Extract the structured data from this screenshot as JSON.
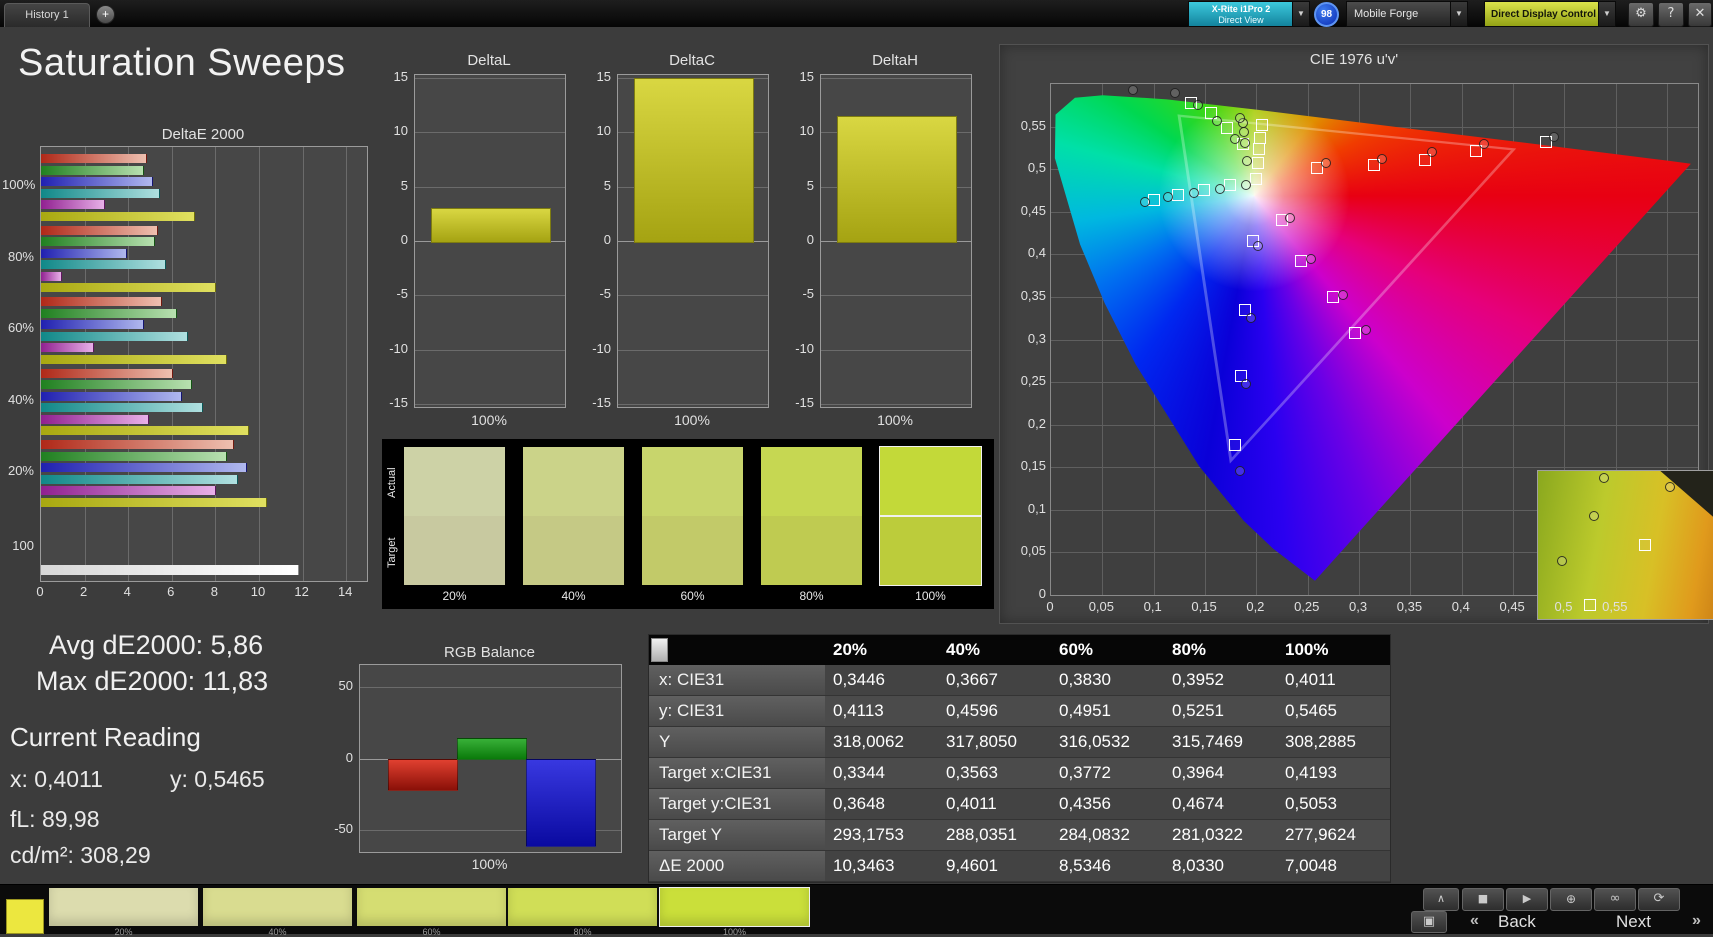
{
  "topbar": {
    "history_tab": "History 1",
    "meter": {
      "line1": "X-Rite i1Pro 2",
      "line2": "Direct View"
    },
    "badge": "98",
    "source": "Mobile Forge",
    "display_control": "Direct Display Control"
  },
  "icons": {
    "gear": "⚙",
    "help": "?",
    "close": "✕",
    "dropdown": "▼",
    "add": "+",
    "collapse": "∧",
    "stop": "■",
    "play": "▶",
    "record": "⊕",
    "loop": "∞",
    "refresh": "⟳",
    "layout": "▣",
    "prev": "«",
    "next": "»"
  },
  "title": "Saturation Sweeps",
  "charts": {
    "deltae2000": {
      "type": "bar",
      "orientation": "horizontal",
      "title": "DeltaE 2000",
      "xlim": [
        0,
        15
      ],
      "xticks": [
        0,
        2,
        4,
        6,
        8,
        10,
        12,
        14
      ],
      "series_names": [
        "Red",
        "Green",
        "Blue",
        "Cyan",
        "Magenta",
        "Yellow"
      ],
      "series_colors": [
        [
          "#b02818",
          "#eec0b0"
        ],
        [
          "#208020",
          "#b8e0b0"
        ],
        [
          "#2020b0",
          "#b0b8ee"
        ],
        [
          "#108888",
          "#b0e0e0"
        ],
        [
          "#902090",
          "#e8b0e8"
        ],
        [
          "#a8a810",
          "#e0e060"
        ]
      ],
      "groups": [
        {
          "label": "100%",
          "values": [
            4.8,
            4.7,
            5.1,
            5.4,
            2.9,
            7.0
          ]
        },
        {
          "label": "80%",
          "values": [
            5.3,
            5.2,
            3.9,
            5.7,
            0.9,
            8.0
          ]
        },
        {
          "label": "60%",
          "values": [
            5.5,
            6.2,
            4.7,
            6.7,
            2.4,
            8.5
          ]
        },
        {
          "label": "40%",
          "values": [
            6.0,
            6.9,
            6.4,
            7.4,
            4.9,
            9.5
          ]
        },
        {
          "label": "20%",
          "values": [
            8.8,
            8.5,
            9.4,
            9.0,
            8.0,
            10.3
          ]
        },
        {
          "label": "100",
          "values": [
            11.8
          ]
        }
      ]
    },
    "deltaL": {
      "type": "bar",
      "title": "DeltaL",
      "ylim": [
        -15,
        15
      ],
      "yticks": [
        15,
        10,
        5,
        0,
        -5,
        -10,
        -15
      ],
      "value": 3.0,
      "xlabel": "100%"
    },
    "deltaC": {
      "type": "bar",
      "title": "DeltaC",
      "ylim": [
        -15,
        15
      ],
      "yticks": [
        15,
        10,
        5,
        0,
        -5,
        -10,
        -15
      ],
      "value": 15.0,
      "xlabel": "100%"
    },
    "deltaH": {
      "type": "bar",
      "title": "DeltaH",
      "ylim": [
        -15,
        15
      ],
      "yticks": [
        15,
        10,
        5,
        0,
        -5,
        -10,
        -15
      ],
      "value": 11.5,
      "xlabel": "100%"
    },
    "rgb_balance": {
      "type": "bar",
      "title": "RGB Balance",
      "ylim": [
        -65,
        65
      ],
      "yticks": [
        50,
        0,
        -50
      ],
      "xlabel": "100%",
      "series": [
        {
          "name": "Red",
          "value": -21
        },
        {
          "name": "Green",
          "value": 14
        },
        {
          "name": "Blue",
          "value": -60
        }
      ],
      "colors": [
        [
          "#e04030",
          "#8a1008"
        ],
        [
          "#38b038",
          "#0a7a0a"
        ],
        [
          "#3838e0",
          "#0a0aa0"
        ]
      ]
    }
  },
  "cie": {
    "title": "CIE 1976 u'v'",
    "xticks": [
      "0",
      "0,05",
      "0,1",
      "0,15",
      "0,2",
      "0,25",
      "0,3",
      "0,35",
      "0,4",
      "0,45",
      "0,5",
      "0,55"
    ],
    "yticks": [
      "0,55",
      "0,5",
      "0,45",
      "0,4",
      "0,35",
      "0,3",
      "0,25",
      "0,2",
      "0,15",
      "0,1",
      "0,05",
      "0"
    ],
    "points": {
      "squares": [
        [
          31.6,
          18.4
        ],
        [
          31.9,
          15.3
        ],
        [
          32.0,
          12.6
        ],
        [
          32.2,
          10.3
        ],
        [
          32.4,
          7.9
        ],
        [
          41.0,
          16.3
        ],
        [
          49.7,
          15.7
        ],
        [
          57.6,
          14.6
        ],
        [
          65.6,
          12.9
        ],
        [
          76.3,
          11.2
        ],
        [
          35.5,
          26.5
        ],
        [
          38.5,
          34.5
        ],
        [
          43.5,
          41.5
        ],
        [
          46.8,
          48.5
        ],
        [
          31.0,
          30.5
        ],
        [
          29.8,
          44.0
        ],
        [
          29.2,
          57.0
        ],
        [
          28.3,
          70.5
        ],
        [
          27.5,
          19.5
        ],
        [
          23.5,
          20.5
        ],
        [
          19.5,
          21.5
        ],
        [
          15.8,
          22.5
        ],
        [
          29.5,
          11.5
        ],
        [
          27.0,
          8.5
        ],
        [
          24.5,
          5.5
        ],
        [
          21.5,
          3.5
        ]
      ],
      "circles": [
        [
          30.2,
          14.9
        ],
        [
          29.9,
          11.4
        ],
        [
          29.7,
          9.2
        ],
        [
          29.5,
          7.5
        ],
        [
          29.1,
          6.4
        ],
        [
          42.3,
          15.2
        ],
        [
          51.0,
          14.4
        ],
        [
          58.8,
          13.2
        ],
        [
          66.8,
          11.6
        ],
        [
          77.6,
          10.2
        ],
        [
          36.8,
          26.0
        ],
        [
          40.0,
          34.0
        ],
        [
          45.0,
          41.0
        ],
        [
          48.5,
          48.0
        ],
        [
          31.8,
          31.5
        ],
        [
          30.8,
          45.5
        ],
        [
          30.0,
          58.5
        ],
        [
          29.0,
          75.5
        ],
        [
          26.0,
          20.3
        ],
        [
          22.0,
          21.2
        ],
        [
          18.0,
          22.0
        ],
        [
          14.3,
          22.8
        ],
        [
          28.3,
          10.5
        ],
        [
          25.5,
          7.0
        ],
        [
          22.5,
          4.0
        ],
        [
          19.0,
          1.5
        ],
        [
          12.5,
          1.0
        ],
        [
          30.0,
          19.5
        ]
      ]
    },
    "inset": {
      "squares": [
        [
          50,
          49
        ],
        [
          24,
          90
        ]
      ],
      "circles": [
        [
          31,
          4
        ],
        [
          11,
          60
        ],
        [
          26,
          30
        ],
        [
          62,
          10
        ]
      ]
    }
  },
  "swatches": {
    "row_labels": [
      "Actual",
      "Target"
    ],
    "columns": [
      {
        "label": "20%",
        "actual": "#cdd2a6",
        "target": "#c8c9a0"
      },
      {
        "label": "40%",
        "actual": "#cbd389",
        "target": "#c5c985"
      },
      {
        "label": "60%",
        "actual": "#c8d56c",
        "target": "#c2ca69"
      },
      {
        "label": "80%",
        "actual": "#c6d752",
        "target": "#bfcb51"
      },
      {
        "label": "100%",
        "actual": "#c3d939",
        "target": "#bccc3b"
      }
    ]
  },
  "stats": {
    "avg": "Avg dE2000: 5,86",
    "max": "Max dE2000: 11,83",
    "current_heading": "Current Reading",
    "x": "x: 0,4011",
    "y": "y: 0,5465",
    "fl": "fL: 89,98",
    "cdm2": "cd/m²: 308,29"
  },
  "table": {
    "columns": [
      "20%",
      "40%",
      "60%",
      "80%",
      "100%"
    ],
    "rows": [
      {
        "label": "x: CIE31",
        "values": [
          "0,3446",
          "0,3667",
          "0,3830",
          "0,3952",
          "0,4011"
        ]
      },
      {
        "label": "y: CIE31",
        "values": [
          "0,4113",
          "0,4596",
          "0,4951",
          "0,5251",
          "0,5465"
        ]
      },
      {
        "label": "Y",
        "values": [
          "318,0062",
          "317,8050",
          "316,0532",
          "315,7469",
          "308,2885"
        ]
      },
      {
        "label": "Target x:CIE31",
        "values": [
          "0,3344",
          "0,3563",
          "0,3772",
          "0,3964",
          "0,4193"
        ]
      },
      {
        "label": "Target y:CIE31",
        "values": [
          "0,3648",
          "0,4011",
          "0,4356",
          "0,4674",
          "0,5053"
        ]
      },
      {
        "label": "Target Y",
        "values": [
          "293,1753",
          "288,0351",
          "284,0832",
          "281,0322",
          "277,9624"
        ]
      },
      {
        "label": "ΔE 2000",
        "values": [
          "10,3463",
          "9,4601",
          "8,5346",
          "8,0330",
          "7,0048"
        ]
      }
    ]
  },
  "bottom_bar": {
    "patches": [
      {
        "label": "20%",
        "color": "#dcdcae"
      },
      {
        "label": "40%",
        "color": "#d9dc90"
      },
      {
        "label": "60%",
        "color": "#d5dd72"
      },
      {
        "label": "80%",
        "color": "#d0de57"
      },
      {
        "label": "100%",
        "color": "#cadf3a",
        "selected": true
      }
    ],
    "nav": {
      "back": "Back",
      "next": "Next"
    }
  }
}
